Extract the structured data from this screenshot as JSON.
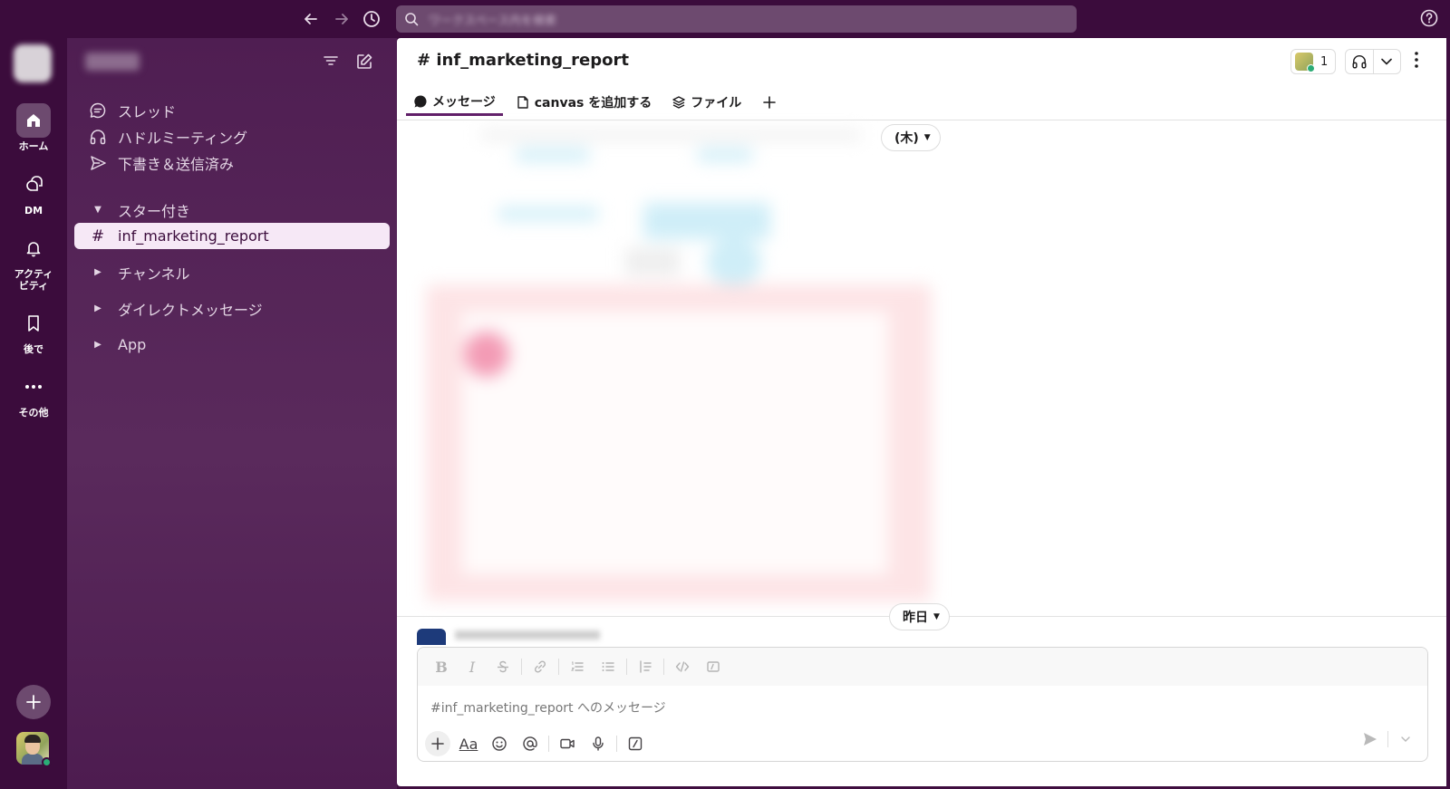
{
  "topbar": {
    "search_placeholder": "ワークスペース内を検索"
  },
  "rail": {
    "items": [
      {
        "label": "ホーム",
        "icon": "home-icon"
      },
      {
        "label": "DM",
        "icon": "dm-icon"
      },
      {
        "label": "アクティビティ",
        "icon": "bell-icon"
      },
      {
        "label": "後で",
        "icon": "bookmark-icon"
      },
      {
        "label": "その他",
        "icon": "more-icon"
      }
    ],
    "activity_line1": "アクティ",
    "activity_line2": "ビティ"
  },
  "sidebar": {
    "nav": [
      {
        "label": "スレッド",
        "icon": "threads-icon"
      },
      {
        "label": "ハドルミーティング",
        "icon": "headphones-icon"
      },
      {
        "label": "下書き＆送信済み",
        "icon": "send-icon"
      }
    ],
    "starred_label": "スター付き",
    "active_channel": "inf_marketing_report",
    "sections": [
      {
        "label": "チャンネル"
      },
      {
        "label": "ダイレクトメッセージ"
      },
      {
        "label": "App"
      }
    ]
  },
  "channel": {
    "title": "# inf_marketing_report",
    "member_count": "1",
    "tabs": [
      {
        "label": "メッセージ",
        "icon": "message-icon"
      },
      {
        "label": "canvas を追加する",
        "icon": "canvas-icon"
      },
      {
        "label": "ファイル",
        "icon": "files-icon"
      }
    ]
  },
  "messages": {
    "date_top": "(木)",
    "date_bottom": "昨日"
  },
  "composer": {
    "placeholder": "#inf_marketing_report へのメッセージ",
    "aa_label": "Aa"
  },
  "colors": {
    "aubergine": "#3f0e40",
    "sidebar": "#5a2a5c",
    "active_row": "#f6e8f6",
    "accent": "#611f69"
  }
}
